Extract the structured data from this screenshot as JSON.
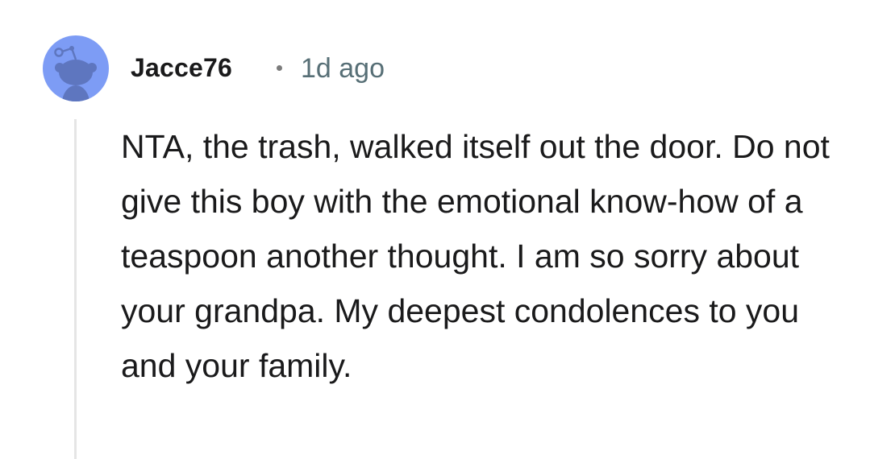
{
  "comment": {
    "author": "Jacce76",
    "separator": "•",
    "timestamp": "1d ago",
    "avatar_icon": "snoo-avatar-icon",
    "body": "NTA, the trash, walked itself out the door. Do not give this boy with the emotional know-how of a teaspoon another thought. I am so sorry about your grandpa. My deepest condolences to you and your family."
  },
  "colors": {
    "avatar_bg": "#7d9cf5",
    "avatar_figure": "#5e76bf",
    "author_text": "#1a1a1b",
    "timestamp_text": "#576f76",
    "thread_line": "#e5e5e5"
  }
}
